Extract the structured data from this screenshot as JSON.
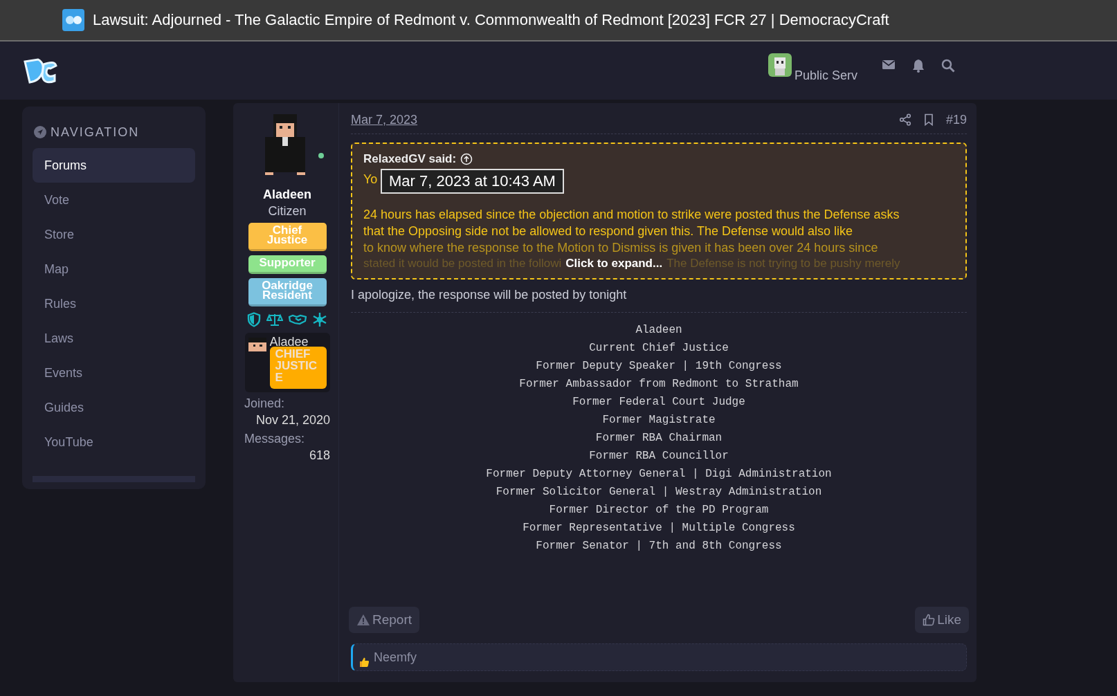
{
  "window": {
    "title": "Lawsuit: Adjourned - The Galactic Empire of Redmont v. Commonwealth of Redmont [2023] FCR 27 | DemocracyCraft"
  },
  "header": {
    "username": "Public Serv"
  },
  "sidebar": {
    "title": "NAVIGATION",
    "items": [
      {
        "label": "Forums",
        "selected": true
      },
      {
        "label": "Vote",
        "selected": false
      },
      {
        "label": "Store",
        "selected": false
      },
      {
        "label": "Map",
        "selected": false
      },
      {
        "label": "Rules",
        "selected": false
      },
      {
        "label": "Laws",
        "selected": false
      },
      {
        "label": "Events",
        "selected": false
      },
      {
        "label": "Guides",
        "selected": false
      },
      {
        "label": "YouTube",
        "selected": false
      }
    ]
  },
  "post": {
    "author": {
      "name": "Aladeen",
      "title": "Citizen",
      "online": true,
      "banners": [
        {
          "label": "Chief Justice",
          "color": "#fbbf45"
        },
        {
          "label": "Supporter",
          "color": "#8ee38c"
        },
        {
          "label": "Oakridge Resident",
          "color": "#7cc2df"
        }
      ],
      "card": {
        "name": "Aladee",
        "badge": "CHIEF JUSTICE"
      },
      "stats": [
        {
          "label": "Joined:",
          "value": "Nov 21, 2020"
        },
        {
          "label": "Messages:",
          "value": "618"
        }
      ]
    },
    "date": "Mar 7, 2023",
    "number": "#19",
    "quote": {
      "author": "RelaxedGV said:",
      "tooltip": "Mar 7, 2023 at 10:43 AM",
      "first_line": "Yo",
      "paragraph": "24 hours has elapsed since the objection and motion to strike were posted thus the Defense asks that the Opposing side not be allowed to respond given this. The Defense would also like",
      "faded_line": "to know where the response to the Motion to Dismiss is given it has been over 24 hours since",
      "cut_line": [
        "stated it would be posted in the followi",
        "The Defense is not trying to be pushy merely"
      ],
      "expand": "Click to expand..."
    },
    "body": "I apologize, the response will be posted by tonight",
    "signature": [
      "Aladeen",
      "Current Chief Justice",
      "Former Deputy Speaker | 19th Congress",
      "Former Ambassador from Redmont to Stratham",
      "Former Federal Court Judge",
      "Former Magistrate",
      "Former RBA Chairman",
      "Former RBA Councillor",
      "Former Deputy Attorney General | Digi Administration",
      "Former Solicitor General | Westray Administration",
      "Former Director of the PD Program",
      "Former Representative | Multiple Congress",
      "Former Senator | 7th and 8th Congress"
    ],
    "actions": {
      "report": "Report",
      "like": "Like"
    },
    "reactions": {
      "users": "Neemfy"
    }
  }
}
